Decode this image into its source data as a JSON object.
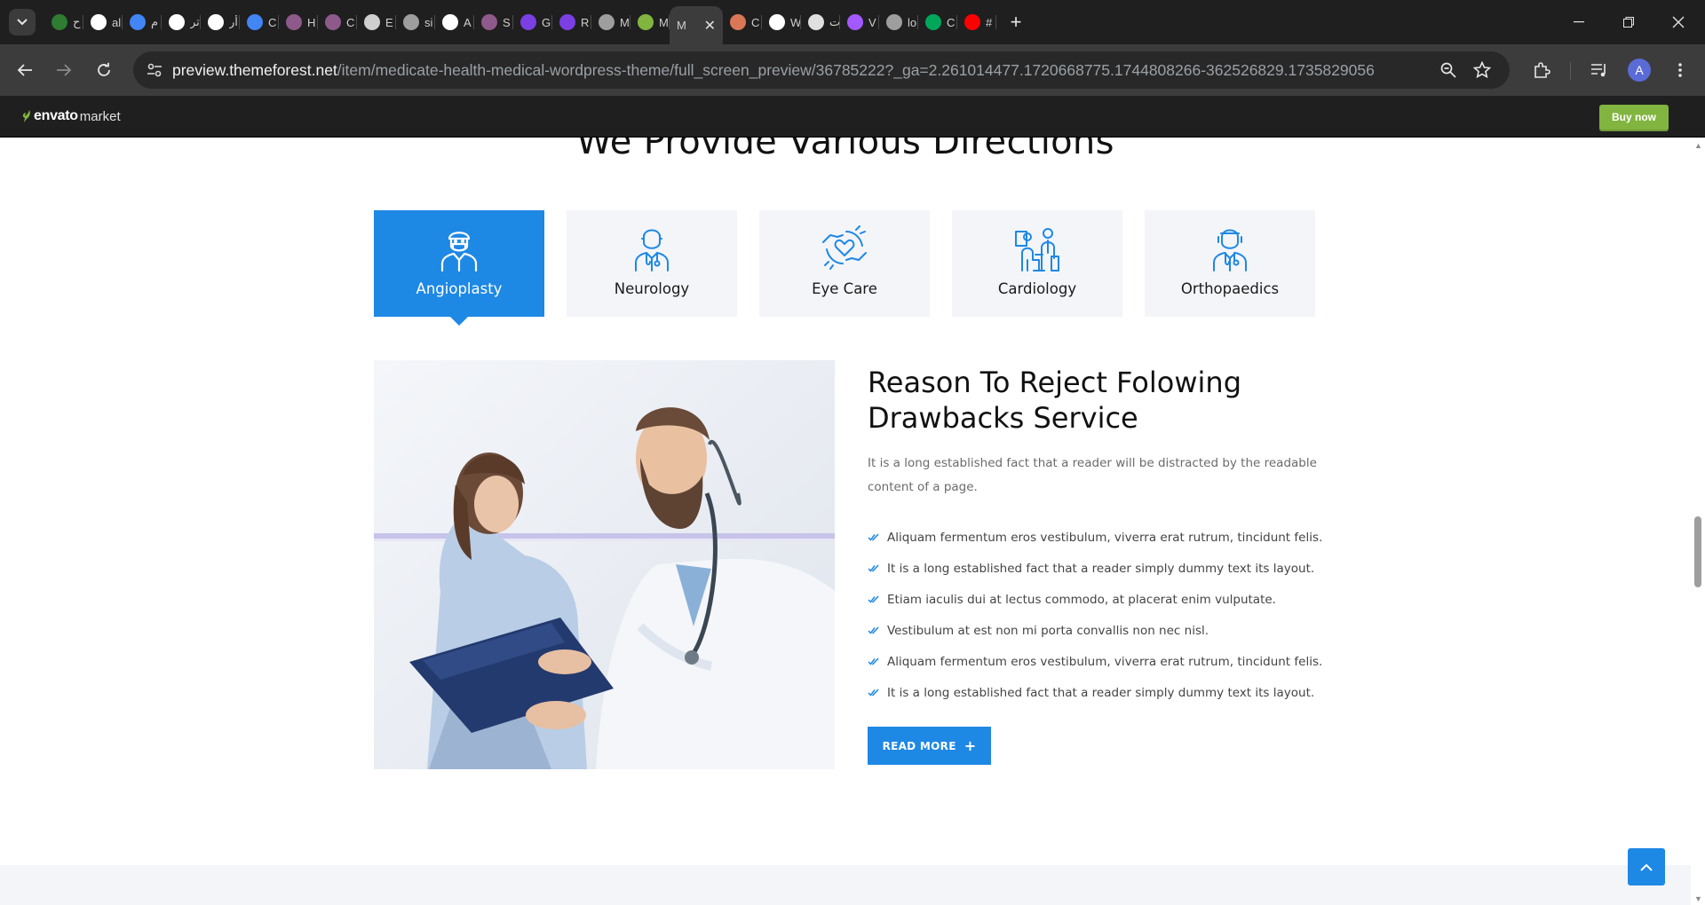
{
  "browser": {
    "tabs": [
      {
        "title": "ح",
        "icon": "plant-icon",
        "color": "#2e7d32"
      },
      {
        "title": "al",
        "icon": "blank-page-icon",
        "color": "#ffffff"
      },
      {
        "title": "م",
        "icon": "google-icon",
        "color": "#4285f4"
      },
      {
        "title": "تر",
        "icon": "openai-icon",
        "color": "#ffffff"
      },
      {
        "title": "أر",
        "icon": "openai-icon",
        "color": "#ffffff"
      },
      {
        "title": "C",
        "icon": "google-icon",
        "color": "#4285f4"
      },
      {
        "title": "H",
        "icon": "circle-icon",
        "color": "#8e5a8a"
      },
      {
        "title": "C",
        "icon": "circle-icon",
        "color": "#8e5a8a"
      },
      {
        "title": "E",
        "icon": "puzzle-icon",
        "color": "#cfcfcf"
      },
      {
        "title": "si",
        "icon": "globe-icon",
        "color": "#9e9e9e"
      },
      {
        "title": "A",
        "icon": "github-icon",
        "color": "#ffffff"
      },
      {
        "title": "S",
        "icon": "circle-icon",
        "color": "#8e5a8a"
      },
      {
        "title": "G",
        "icon": "chat-icon",
        "color": "#7b3fe4"
      },
      {
        "title": "R",
        "icon": "chat-icon",
        "color": "#7b3fe4"
      },
      {
        "title": "M",
        "icon": "chrome-icon",
        "color": "#9e9e9e"
      },
      {
        "title": "M",
        "icon": "envato-icon",
        "color": "#82b440"
      },
      {
        "title": "M",
        "icon": "none",
        "color": "#3c3c3c",
        "active": true
      },
      {
        "title": "C",
        "icon": "claude-icon",
        "color": "#d97757"
      },
      {
        "title": "W",
        "icon": "x-icon",
        "color": "#ffffff"
      },
      {
        "title": "ت",
        "icon": "no-icon",
        "color": "#e0e0e0"
      },
      {
        "title": "V",
        "icon": "vite-icon",
        "color": "#a259ff"
      },
      {
        "title": "lo",
        "icon": "globe-icon",
        "color": "#9e9e9e"
      },
      {
        "title": "C",
        "icon": "leaf-icon",
        "color": "#00a65a"
      },
      {
        "title": "#",
        "icon": "youtube-icon",
        "color": "#ff0000"
      }
    ],
    "url_host": "preview.themeforest.net",
    "url_path": "/item/medicate-health-medical-wordpress-theme/full_screen_preview/36785222?_ga=2.261014477.1720668775.1744808266-362526829.1735829056",
    "profile_initial": "A"
  },
  "envato": {
    "logo_brand": "envato",
    "logo_market": "market",
    "buy_now": "Buy now"
  },
  "page": {
    "section_title": "We Provide Various Directions",
    "departments": [
      {
        "label": "Angioplasty",
        "active": true
      },
      {
        "label": "Neurology",
        "active": false
      },
      {
        "label": "Eye Care",
        "active": false
      },
      {
        "label": "Cardiology",
        "active": false
      },
      {
        "label": "Orthopaedics",
        "active": false
      }
    ],
    "heading": "Reason To Reject Folowing Drawbacks Service",
    "lead": "It is a long established fact that a reader will be distracted by the readable content of a page.",
    "bullets": [
      "Aliquam fermentum eros vestibulum, viverra erat rutrum, tincidunt felis.",
      "It is a long established fact that a reader simply dummy text its layout.",
      "Etiam iaculis dui at lectus commodo, at placerat enim vulputate.",
      "Vestibulum at est non mi porta convallis non nec nisl.",
      "Aliquam fermentum eros vestibulum, viverra erat rutrum, tincidunt felis.",
      "It is a long established fact that a reader simply dummy text its layout."
    ],
    "read_more": "READ MORE",
    "accent_color": "#1e88e5"
  }
}
